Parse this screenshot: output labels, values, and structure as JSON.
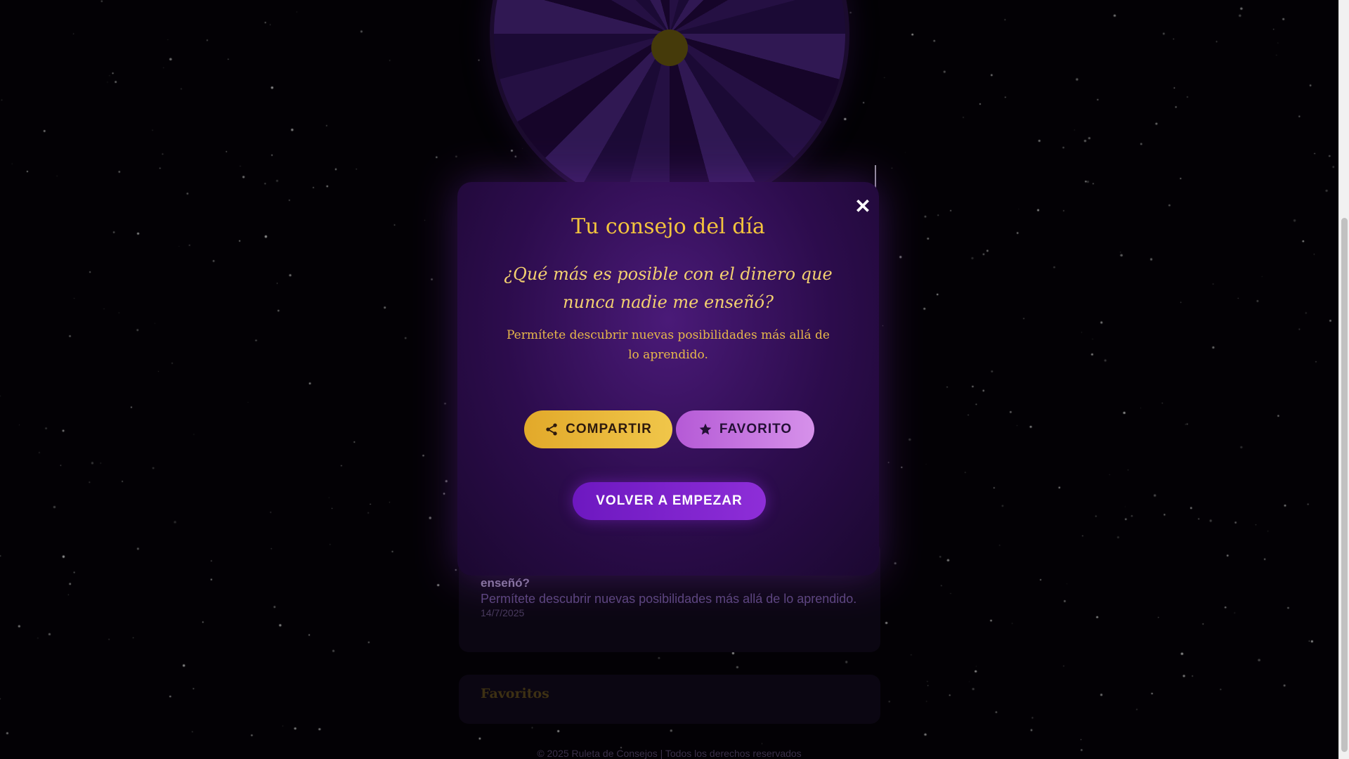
{
  "background": {
    "color": "#050308"
  },
  "modal": {
    "title": "Tu consejo del día",
    "question": "¿Qué más es posible con el dinero que nunca nadie me enseñó?",
    "description": "Permítete descubrir nuevas posibilidades más allá de lo aprendido.",
    "close_icon": "close-icon",
    "share_label": "COMPARTIR",
    "share_icon": "share-icon",
    "favorite_label": "FAVORITO",
    "favorite_icon": "star-icon",
    "restart_label": "VOLVER A EMPEZAR",
    "colors": {
      "title": "#f3c43d",
      "share_button": "#e8b535",
      "favorite_button": "#c877e0",
      "restart_button": "#7a22c9"
    }
  },
  "history": {
    "question_tail": "enseñó?",
    "description": "Permítete descubrir nuevas posibilidades más allá de lo aprendido.",
    "date": "14/7/2025"
  },
  "favorites": {
    "title": "Favoritos"
  },
  "footer": {
    "text": "© 2025 Ruleta de Consejos | Todos los derechos reservados"
  }
}
